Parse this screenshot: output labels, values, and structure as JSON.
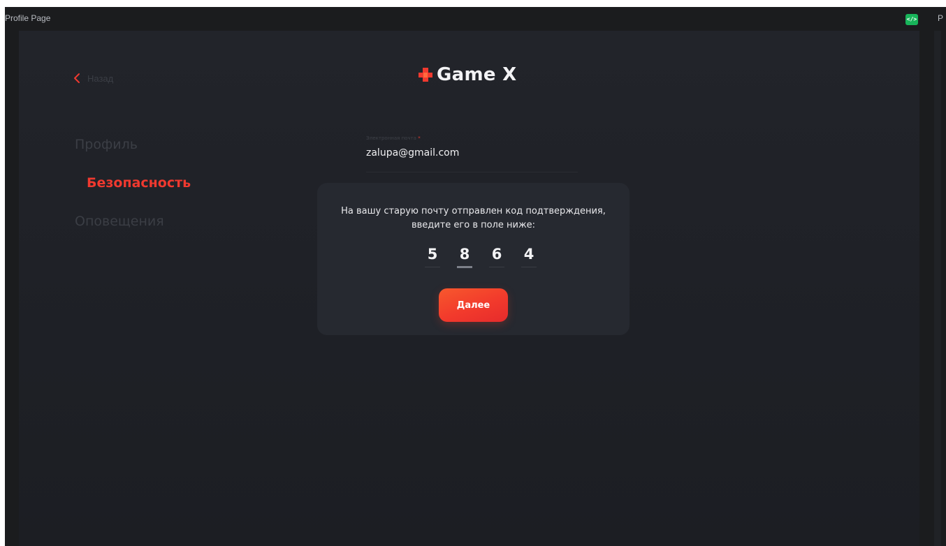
{
  "window": {
    "title": "Profile Page",
    "edge_letter": "P",
    "code_badge": "</>"
  },
  "header": {
    "back_label": "Назад",
    "logo_text": "Game X"
  },
  "sidebar": {
    "items": [
      {
        "label": "Профиль",
        "active": false
      },
      {
        "label": "Безопасность",
        "active": true
      },
      {
        "label": "Оповещения",
        "active": false
      }
    ]
  },
  "email_field": {
    "label": "Электронная почта",
    "required_mark": "*",
    "value": "zalupa@gmail.com"
  },
  "modal": {
    "message_line1": "На вашу старую почту отправлен код подтверждения,",
    "message_line2": "введите его в поле ниже:",
    "code_digits": [
      "5",
      "8",
      "6",
      "4"
    ],
    "active_digit_index": 1,
    "submit_label": "Далее"
  },
  "colors": {
    "accent": "#f0392f",
    "background": "#1f2127",
    "modal": "#262930",
    "badge": "#18b45a"
  }
}
